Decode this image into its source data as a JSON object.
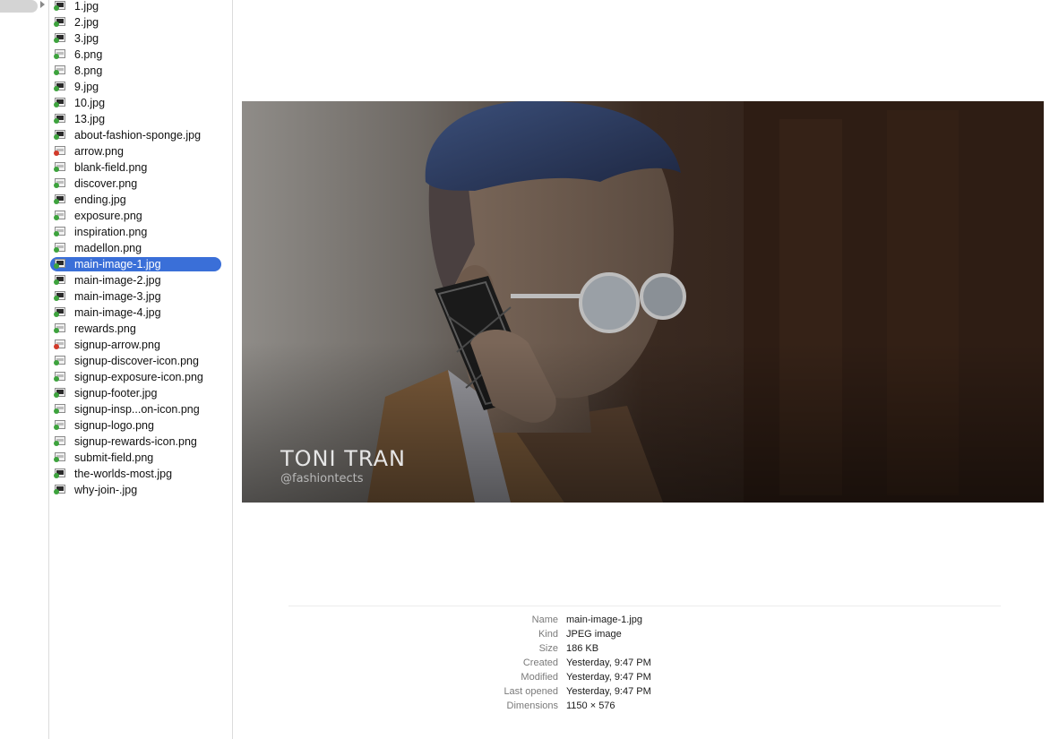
{
  "files": [
    {
      "name": "1.jpg",
      "type": "jpg"
    },
    {
      "name": "2.jpg",
      "type": "jpg"
    },
    {
      "name": "3.jpg",
      "type": "jpg"
    },
    {
      "name": "6.png",
      "type": "png"
    },
    {
      "name": "8.png",
      "type": "png"
    },
    {
      "name": "9.jpg",
      "type": "jpg"
    },
    {
      "name": "10.jpg",
      "type": "jpg"
    },
    {
      "name": "13.jpg",
      "type": "jpg"
    },
    {
      "name": "about-fashion-sponge.jpg",
      "type": "jpg"
    },
    {
      "name": "arrow.png",
      "type": "png-red"
    },
    {
      "name": "blank-field.png",
      "type": "png"
    },
    {
      "name": "discover.png",
      "type": "png"
    },
    {
      "name": "ending.jpg",
      "type": "jpg"
    },
    {
      "name": "exposure.png",
      "type": "png"
    },
    {
      "name": "inspiration.png",
      "type": "png"
    },
    {
      "name": "madellon.png",
      "type": "png"
    },
    {
      "name": "main-image-1.jpg",
      "type": "jpg",
      "selected": true
    },
    {
      "name": "main-image-2.jpg",
      "type": "jpg"
    },
    {
      "name": "main-image-3.jpg",
      "type": "jpg"
    },
    {
      "name": "main-image-4.jpg",
      "type": "jpg"
    },
    {
      "name": "rewards.png",
      "type": "png"
    },
    {
      "name": "signup-arrow.png",
      "type": "png-red"
    },
    {
      "name": "signup-discover-icon.png",
      "type": "png"
    },
    {
      "name": "signup-exposure-icon.png",
      "type": "png"
    },
    {
      "name": "signup-footer.jpg",
      "type": "jpg"
    },
    {
      "name": "signup-insp...on-icon.png",
      "type": "png"
    },
    {
      "name": "signup-logo.png",
      "type": "png"
    },
    {
      "name": "signup-rewards-icon.png",
      "type": "png"
    },
    {
      "name": "submit-field.png",
      "type": "png"
    },
    {
      "name": "the-worlds-most.jpg",
      "type": "jpg"
    },
    {
      "name": "why-join-.jpg",
      "type": "jpg"
    }
  ],
  "preview": {
    "caption_name": "TONI TRAN",
    "caption_handle": "@fashiontects"
  },
  "info": [
    {
      "label": "Name",
      "value": "main-image-1.jpg"
    },
    {
      "label": "Kind",
      "value": "JPEG image"
    },
    {
      "label": "Size",
      "value": "186 KB"
    },
    {
      "label": "Created",
      "value": "Yesterday, 9:47 PM"
    },
    {
      "label": "Modified",
      "value": "Yesterday, 9:47 PM"
    },
    {
      "label": "Last opened",
      "value": "Yesterday, 9:47 PM"
    },
    {
      "label": "Dimensions",
      "value": "1150 × 576"
    }
  ],
  "colors": {
    "selection": "#3a6fd8",
    "check": "#3da33d",
    "red_badge": "#d23a2a"
  }
}
